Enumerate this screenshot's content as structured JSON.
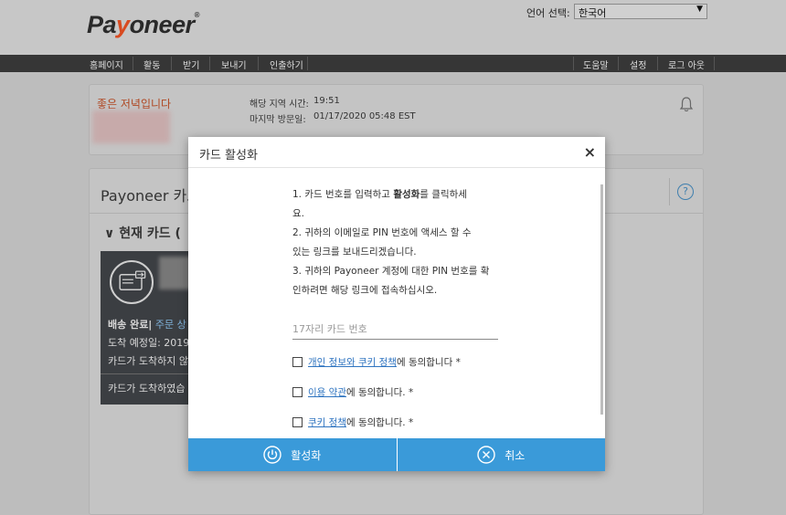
{
  "header": {
    "logo": {
      "pa": "Pa",
      "y": "y",
      "rest": "oneer",
      "reg": "®"
    },
    "lang_label": "언어 선택:",
    "lang_selected": "한국어"
  },
  "nav": {
    "left": [
      "홈페이지",
      "활동",
      "받기",
      "보내기",
      "인출하기"
    ],
    "right": [
      "도움말",
      "설정",
      "로그 아웃"
    ]
  },
  "greeting": {
    "text": "좋은 저녁입니다",
    "local_time_label": "해당 지역 시간:",
    "local_time": "19:51",
    "last_visit_label": "마지막 방문일:",
    "last_visit": "01/17/2020 05:48 EST"
  },
  "card_section": {
    "title": "Payoneer 카드",
    "help": "?",
    "current_card": "현재 카드 (",
    "panel": {
      "line1_bold": "배송 완료|",
      "line1_link": "주문 상",
      "line2": "도착 예정일: 2019",
      "line3": "카드가 도착하지 않",
      "line4": "카드가 도착하였습"
    }
  },
  "modal": {
    "title": "카드 활성화",
    "close": "×",
    "instructions": {
      "l1a": "1. 카드 번호를 입력하고 ",
      "l1b": "활성화",
      "l1c": "를 클릭하세",
      "l2": "요.",
      "l3": "2. 귀하의 이메일로 PIN 번호에 액세스 할 수",
      "l4": "있는 링크를 보내드리겠습니다.",
      "l5": "3. 귀하의 Payoneer 계정에 대한 PIN 번호를 확",
      "l6": "인하려면 해당 링크에 접속하십시오."
    },
    "card_input_placeholder": "17자리 카드 번호",
    "checkboxes": [
      {
        "link": "개인 정보와 쿠키 정책",
        "text": "에 동의합니다 *"
      },
      {
        "link": "이용 약관",
        "text": "에 동의합니다. *"
      },
      {
        "link": "쿠키 정책",
        "text": "에 동의합니다. *"
      }
    ],
    "activate_button": "활성화",
    "cancel_button": "취소"
  },
  "colors": {
    "accent": "#3a9ad9",
    "greeting": "#b04621",
    "link": "#2f74c0",
    "nav": "#363636"
  }
}
